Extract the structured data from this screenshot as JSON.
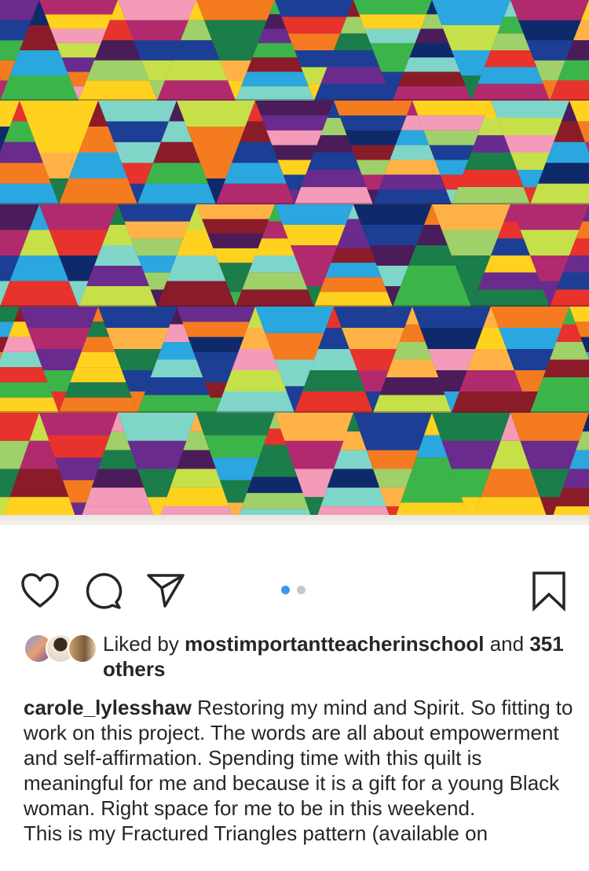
{
  "post": {
    "image_description_icon": "quilt-photo"
  },
  "actions": {
    "like_icon": "heart-icon",
    "comment_icon": "comment-bubble-icon",
    "share_icon": "paper-plane-icon",
    "save_icon": "bookmark-icon",
    "carousel": {
      "total": 2,
      "active": 1
    }
  },
  "likes": {
    "prefix": "Liked by",
    "user": "mostimportantteacherinschool",
    "conjunction": "and",
    "others": "351 others"
  },
  "caption": {
    "username": "carole_lylesshaw",
    "text": "Restoring my mind and Spirit. So fitting to work on this project. The words are all about empowerment and self-affirmation. Spending time with this quilt is meaningful for me and because it is a gift for a young Black woman. Right space for me to be in this weekend.",
    "second_paragraph": "This is my Fractured Triangles pattern (available on"
  },
  "colors": {
    "accent": "#3897f0",
    "text": "#262626",
    "dot_inactive": "#c7c7c7"
  }
}
